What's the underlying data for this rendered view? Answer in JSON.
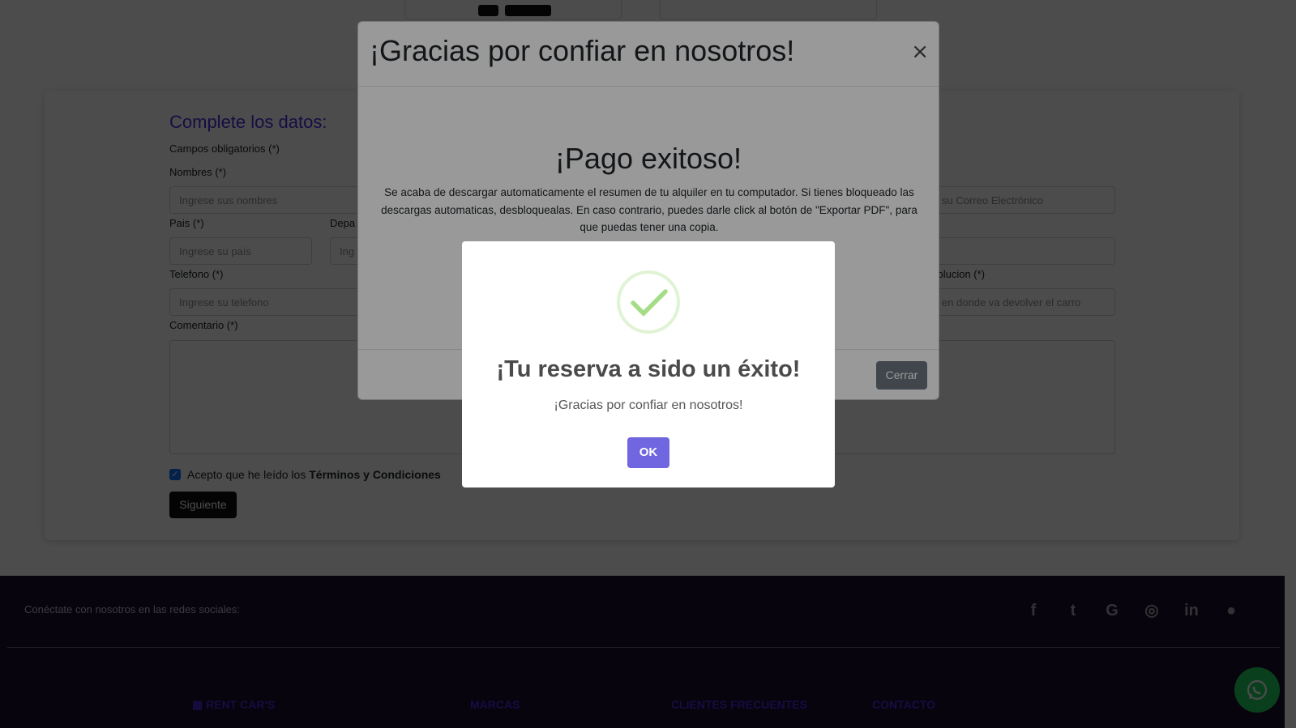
{
  "form": {
    "title": "Complete los datos:",
    "required_note": "Campos obligatorios (*)",
    "nombres_label": "Nombres (*)",
    "nombres_placeholder": "Ingrese sus nombres",
    "correo_placeholder": "su Correo Electrónico",
    "pais_label": "Pais (*)",
    "pais_placeholder": "Ingrese su país",
    "depa_label": "Depa",
    "depa_placeholder": "Ing",
    "telefono_label": "Telefono (*)",
    "telefono_placeholder": "Ingrese su telefono",
    "devolucion_label": "volucion (*)",
    "devolucion_placeholder": "en donde va devolver el carro",
    "comentario_label": "Comentario (*)",
    "terms_prefix": "Acepto que he leído los",
    "terms_link": "Términos y Condiciones",
    "next_button": "Siguiente"
  },
  "footer": {
    "social_text": "Conéctate con nosotros en las redes sociales:",
    "social_icons": [
      "facebook-icon",
      "twitter-icon",
      "google-icon",
      "instagram-icon",
      "linkedin-icon",
      "github-icon"
    ],
    "brand": "RENT CAR'S",
    "col_marcas": "MARCAS",
    "col_clientes": "CLIENTES FRECUENTES",
    "col_contacto": "CONTACTO"
  },
  "modal": {
    "title": "¡Gracias por confiar en nosotros!",
    "close_glyph": "×",
    "body_title": "¡Pago exitoso!",
    "body_text": "Se acaba de descargar automaticamente el resumen de tu alquiler en tu computador. Si tienes bloqueado las descargas automaticas, desbloquealas. En caso contrario, puedes darle click al botón de \"Exportar PDF\", para que puedas tener una copia.",
    "close_button": "Cerrar"
  },
  "alert": {
    "title": "¡Tu reserva a sido un éxito!",
    "text": "¡Gracias por confiar en nosotros!",
    "ok_button": "OK",
    "icon": "success-check-icon"
  },
  "colors": {
    "accent": "#4b2fe0",
    "alert_button": "#7066e0",
    "success_check": "#a5dc86",
    "footer_bg": "#1b0f2e",
    "whatsapp": "#25d366"
  }
}
